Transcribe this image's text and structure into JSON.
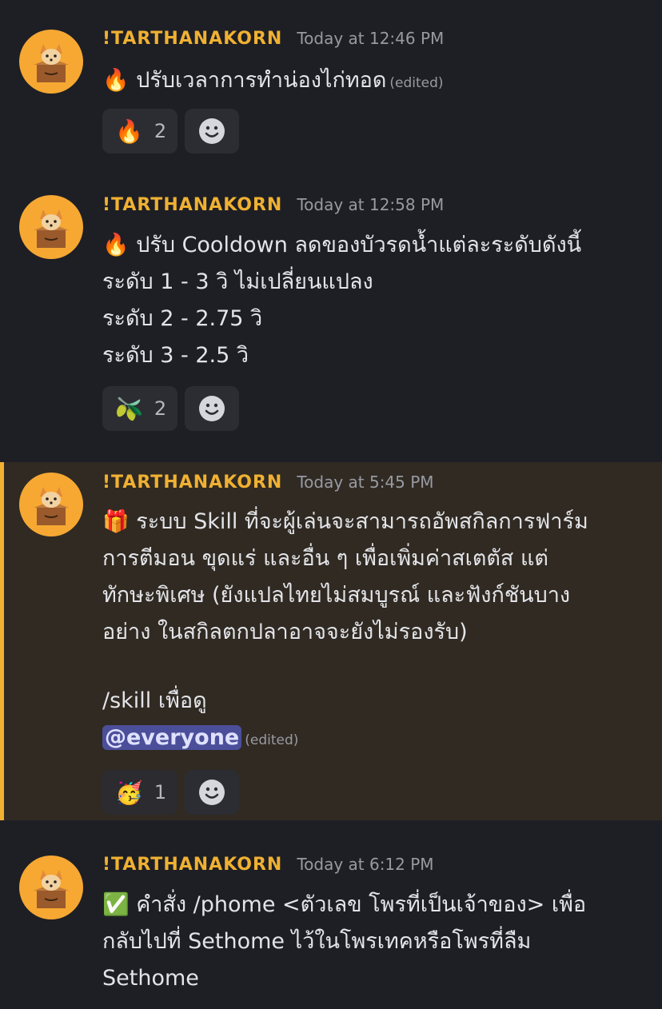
{
  "messages": [
    {
      "username": "!TARTHANAKORN",
      "timestamp": "Today at 12:46 PM",
      "lines": [
        "🔥 ปรับเวลาการทำน่องไก่ทอด"
      ],
      "edited": "(edited)",
      "reactions": [
        {
          "emoji": "🔥",
          "count": "2"
        }
      ]
    },
    {
      "username": "!TARTHANAKORN",
      "timestamp": "Today at 12:58 PM",
      "lines": [
        "🔥 ปรับ Cooldown ลดของบัวรดน้ำแต่ละระดับดังนี้",
        "ระดับ 1 - 3 วิ ไม่เปลี่ยนแปลง",
        "ระดับ 2 - 2.75 วิ",
        "ระดับ 3 - 2.5 วิ"
      ],
      "reactions": [
        {
          "emoji": "🫒",
          "count": "2"
        }
      ]
    },
    {
      "username": "!TARTHANAKORN",
      "timestamp": "Today at 5:45 PM",
      "lines": [
        "🎁 ระบบ Skill ที่จะผู้เล่นจะสามารถอัพสกิลการฟาร์ม",
        "การตีมอน ขุดแร่ และอื่น ๆ เพื่อเพิ่มค่าสเตตัส แต่",
        "ทักษะพิเศษ (ยังแปลไทยไม่สมบูรณ์ และฟังก์ชันบาง",
        "อย่าง ในสกิลตกปลาอาจจะยังไม่รองรับ)",
        "",
        "/skill เพื่อดู"
      ],
      "mention": "@everyone",
      "edited": "(edited)",
      "reactions": [
        {
          "emoji": "🥳",
          "count": "1"
        }
      ]
    },
    {
      "username": "!TARTHANAKORN",
      "timestamp": "Today at 6:12 PM",
      "lines": [
        "✅ คำสั่ง /phome <ตัวเลข โพรที่เป็นเจ้าของ> เพื่อ",
        "กลับไปที่ Sethome ไว้ในโพรเทคหรือโพรที่ลืม",
        "Sethome"
      ]
    }
  ],
  "colors": {
    "background": "#1e1f24",
    "highlight_background": "#302a23",
    "highlight_border": "#f0b132",
    "username": "#f0b132",
    "mention": "#4b4f9a"
  },
  "icons": {
    "avatar": "corgi-in-box-icon",
    "add_reaction": "smiley-face-icon"
  }
}
